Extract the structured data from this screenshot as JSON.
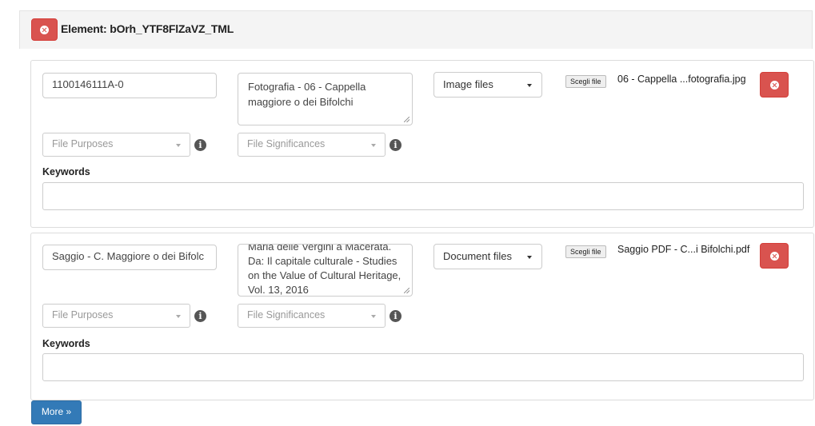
{
  "element": {
    "title": "Element: bOrh_YTF8FlZaVZ_TML"
  },
  "files": [
    {
      "identifier": "1100146111A-0",
      "description": "Fotografia - 06 - Cappella maggiore o dei Bifolchi",
      "file_type": "Image files",
      "choose_label": "Scegli file",
      "file_name": "06 - Cappella ...fotografia.jpg",
      "purposes_placeholder": "File Purposes",
      "significances_placeholder": "File Significances",
      "info_glyph": "i",
      "keywords_label": "Keywords",
      "keywords_value": ""
    },
    {
      "identifier": "Saggio - C. Maggiore o dei Bifolc",
      "description": "Maria delle Vergini a Macerata. Da: Il capitale culturale - Studies on the Value of Cultural Heritage, Vol. 13, 2016",
      "file_type": "Document files",
      "choose_label": "Scegli file",
      "file_name": "Saggio PDF - C...i Bifolchi.pdf",
      "purposes_placeholder": "File Purposes",
      "significances_placeholder": "File Significances",
      "info_glyph": "i",
      "keywords_label": "Keywords",
      "keywords_value": ""
    }
  ],
  "more_button": "More »",
  "colors": {
    "danger": "#d9534f",
    "primary": "#337ab7"
  },
  "icons": [
    "remove-circle-icon",
    "info-icon",
    "caret-down-icon"
  ]
}
